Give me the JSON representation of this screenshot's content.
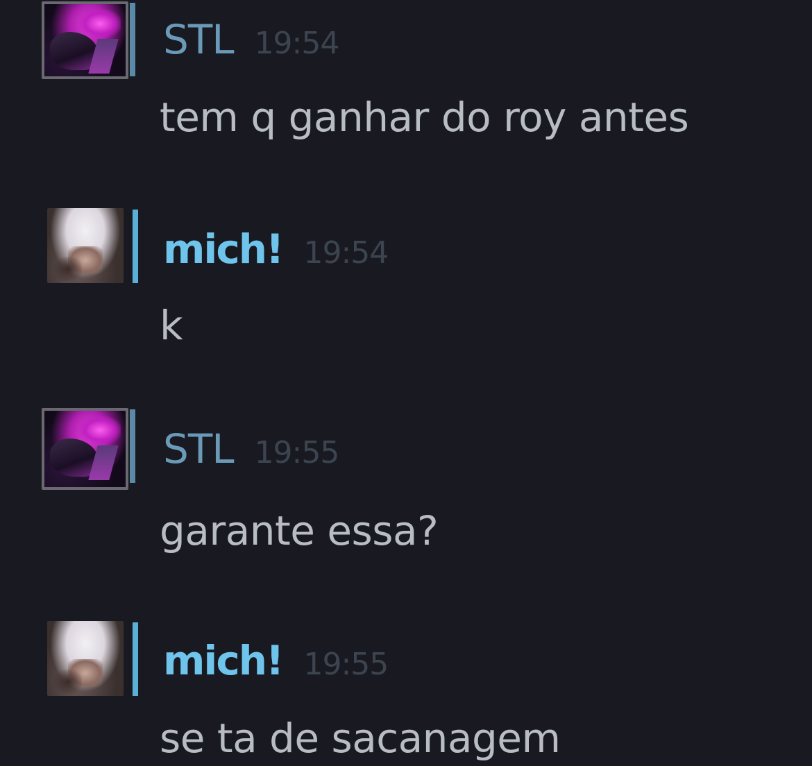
{
  "colors": {
    "background": "#191a21",
    "name_stl": "#6b9ab8",
    "name_mich": "#6fc4ec",
    "timestamp": "#3c4450",
    "message_text": "#b8bcc4",
    "status_stl": "#5a8aa8",
    "status_mich": "#5bb0d8"
  },
  "messages": [
    {
      "user": "STL",
      "time": "19:54",
      "text": "tem q ganhar do roy antes",
      "avatar_icon": "user-avatar-stl"
    },
    {
      "user": "mich!",
      "time": "19:54",
      "text": "k",
      "avatar_icon": "user-avatar-mich"
    },
    {
      "user": "STL",
      "time": "19:55",
      "text": "garante essa?",
      "avatar_icon": "user-avatar-stl"
    },
    {
      "user": "mich!",
      "time": "19:55",
      "text": "se ta de sacanagem",
      "avatar_icon": "user-avatar-mich"
    }
  ]
}
